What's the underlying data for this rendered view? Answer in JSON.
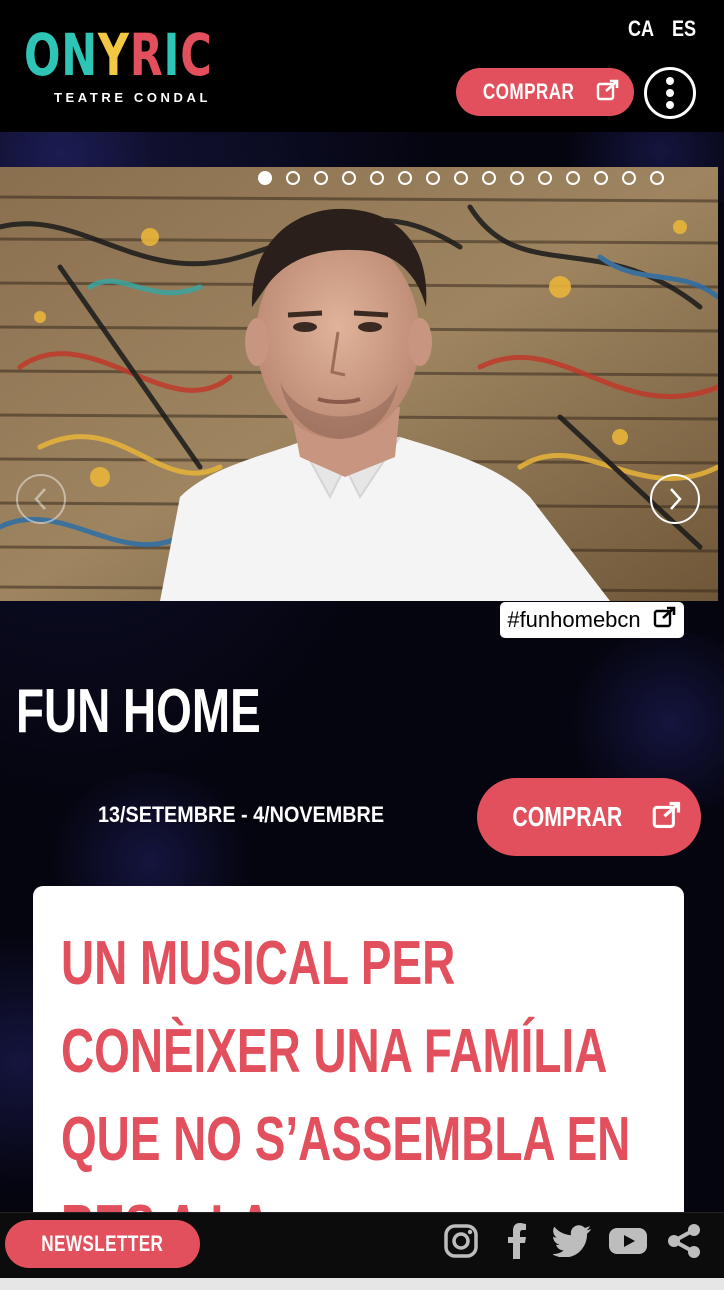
{
  "header": {
    "logo": {
      "word": "ONYRIC",
      "subtitle": "TEATRE CONDAL"
    },
    "languages": [
      "CA",
      "ES"
    ],
    "buy_label": "COMPRAR"
  },
  "carousel": {
    "slide_count": 15,
    "active_index": 0,
    "hashtag": "#funhomebcn"
  },
  "show": {
    "title": "FUN HOME",
    "dates": "13/SETEMBRE - 4/NOVEMBRE",
    "buy_label": "COMPRAR",
    "tagline": "UN MUSICAL PER CONÈIXER UNA FAMÍLIA QUE NO S’ASSEMBLA EN RES A LA"
  },
  "footer": {
    "newsletter_label": "NEWSLETTER",
    "social": [
      "instagram-icon",
      "facebook-icon",
      "twitter-icon",
      "youtube-icon",
      "share-icon"
    ]
  },
  "colors": {
    "accent": "#e1505c",
    "logo_teal": "#2ec4b6",
    "logo_pink": "#e1505c",
    "logo_yellow": "#f2c744",
    "background": "#000000"
  }
}
